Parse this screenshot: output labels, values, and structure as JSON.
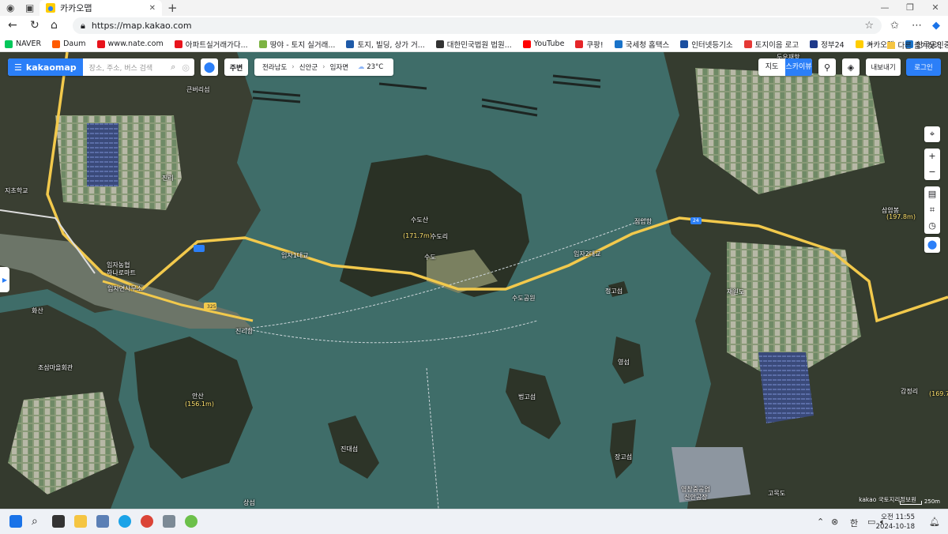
{
  "browser": {
    "tab_title": "카카오맵",
    "url": "https://map.kakao.com",
    "bookmarks": [
      {
        "label": "NAVER",
        "color": "#03c75a"
      },
      {
        "label": "Daum",
        "color": "#ff5a00"
      },
      {
        "label": "www.nate.com",
        "color": "#e8141c"
      },
      {
        "label": "아파트실거래가다...",
        "color": "#e8141c"
      },
      {
        "label": "땅야 - 토지 실거래...",
        "color": "#7cb342"
      },
      {
        "label": "토지, 빌딩, 상가 거...",
        "color": "#1e5aa8"
      },
      {
        "label": "대한민국법원 법원...",
        "color": "#333333"
      },
      {
        "label": "YouTube",
        "color": "#ff0000"
      },
      {
        "label": "쿠팡!",
        "color": "#e52528"
      },
      {
        "label": "국세청 홈택스",
        "color": "#1a73c9"
      },
      {
        "label": "인터넷등기소",
        "color": "#1a4fa0"
      },
      {
        "label": "토지이음 로고",
        "color": "#e53935"
      },
      {
        "label": "정부24",
        "color": "#1e3a8a"
      },
      {
        "label": "카카오맵",
        "color": "#ffcd00"
      },
      {
        "label": "한국공인중개사협회",
        "color": "#1a73c9"
      }
    ],
    "other_bookmarks": "다른 즐겨찾기"
  },
  "kakaomap": {
    "brand": "kakaomap",
    "search_placeholder": "장소, 주소, 버스 검색",
    "nearby": "주변",
    "breadcrumb": [
      "전라남도",
      "신안군",
      "임자면"
    ],
    "weather": "23°C",
    "mode_map": "지도",
    "mode_skyview": "스카이뷰",
    "export": "내보내기",
    "login": "로그인",
    "copyright": "kakao 국토지리정보원",
    "scale": "250m"
  },
  "map_labels": [
    {
      "text": "큰버리섬",
      "c": "w"
    },
    {
      "text": "진리",
      "c": "w"
    },
    {
      "text": "지초학교",
      "c": "w"
    },
    {
      "text": "임자1대교",
      "c": "w"
    },
    {
      "text": "수도산",
      "c": "w"
    },
    {
      "text": "(171.7m)",
      "c": "y"
    },
    {
      "text": "수도리",
      "c": "w"
    },
    {
      "text": "수도",
      "c": "w"
    },
    {
      "text": "수도공원",
      "c": "w"
    },
    {
      "text": "임자2대교",
      "c": "w"
    },
    {
      "text": "점암항",
      "c": "w"
    },
    {
      "text": "삼암봉",
      "c": "w"
    },
    {
      "text": "(197.8m)",
      "c": "y"
    },
    {
      "text": "임자농협",
      "c": "w"
    },
    {
      "text": "하나로마트",
      "c": "w"
    },
    {
      "text": "임자면사무소",
      "c": "w"
    },
    {
      "text": "화산",
      "c": "w"
    },
    {
      "text": "진리항",
      "c": "w"
    },
    {
      "text": "조삼마을회관",
      "c": "w"
    },
    {
      "text": "안산",
      "c": "w"
    },
    {
      "text": "(156.1m)",
      "c": "y"
    },
    {
      "text": "정고섬",
      "c": "w"
    },
    {
      "text": "영섬",
      "c": "w"
    },
    {
      "text": "법고섬",
      "c": "w"
    },
    {
      "text": "재원도",
      "c": "w"
    },
    {
      "text": "진대섬",
      "c": "w"
    },
    {
      "text": "장고섬",
      "c": "w"
    },
    {
      "text": "감정리",
      "c": "w"
    },
    {
      "text": "(169.7m)",
      "c": "y"
    },
    {
      "text": "영창중공업",
      "c": "w"
    },
    {
      "text": "신안공장",
      "c": "w"
    },
    {
      "text": "고목도",
      "c": "w"
    },
    {
      "text": "상섬",
      "c": "w"
    },
    {
      "text": "두우재항",
      "c": "w"
    },
    {
      "text": "24",
      "c": "w"
    },
    {
      "text": "325",
      "c": "w"
    }
  ],
  "taskbar": {
    "ime": "한",
    "time": "오전 11:55",
    "date": "2024-10-18"
  }
}
